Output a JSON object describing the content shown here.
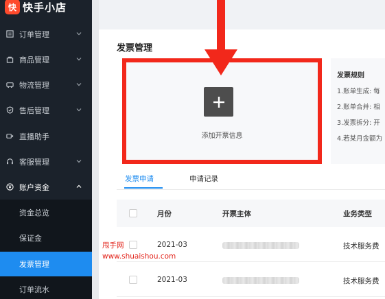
{
  "brand": {
    "logo_text": "快",
    "name": "快手小店"
  },
  "sidebar": {
    "items": [
      {
        "label": "订单管理",
        "icon": "list-icon",
        "expanded": false
      },
      {
        "label": "商品管理",
        "icon": "bag-icon",
        "expanded": false
      },
      {
        "label": "物流管理",
        "icon": "truck-icon",
        "expanded": false
      },
      {
        "label": "售后管理",
        "icon": "shield-icon",
        "expanded": false
      },
      {
        "label": "直播助手",
        "icon": "video-icon",
        "expanded": null
      },
      {
        "label": "客服管理",
        "icon": "headset-icon",
        "expanded": false
      },
      {
        "label": "账户资金",
        "icon": "yen-icon",
        "expanded": true
      }
    ],
    "sub_items": [
      {
        "label": "资金总览",
        "active": false
      },
      {
        "label": "保证金",
        "active": false
      },
      {
        "label": "发票管理",
        "active": true
      },
      {
        "label": "订单流水",
        "active": false
      }
    ]
  },
  "main": {
    "title": "发票管理",
    "add_invoice_label": "添加开票信息",
    "rules": {
      "title": "发票规则",
      "lines": [
        "1.账单生成: 每",
        "2.账单合并: 相",
        "3.发票拆分: 开",
        "4.若某月金额为"
      ]
    },
    "tabs": [
      {
        "label": "发票申请",
        "active": true
      },
      {
        "label": "申请记录",
        "active": false
      }
    ],
    "table": {
      "columns": [
        "月份",
        "开票主体",
        "业务类型"
      ],
      "rows": [
        {
          "month": "2021-03",
          "entity": "",
          "type": "技术服务费"
        },
        {
          "month": "2021-03",
          "entity": "",
          "type": "技术服务费"
        }
      ]
    }
  },
  "watermark": {
    "line1": "甩手网",
    "line2": "www.shuaishou.com"
  },
  "colors": {
    "accent": "#1e8cf0",
    "highlight": "#f2281b",
    "sidebar_bg": "#1b222b",
    "brand": "#fe4a2c"
  }
}
